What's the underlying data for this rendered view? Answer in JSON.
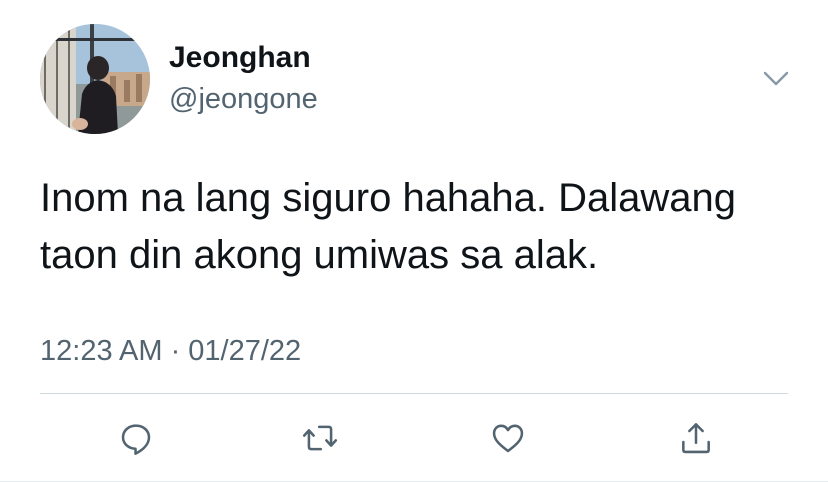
{
  "tweet": {
    "author": {
      "display_name": "Jeonghan",
      "handle": "@jeongone",
      "avatar_icon": "profile-photo"
    },
    "text_lines": [
      "Inom na lang siguro hahaha. Dalawang",
      "taon din akong umiwas sa alak."
    ],
    "timestamp": "12:23 AM · 01/27/22",
    "menu_icon": "chevron-down-icon",
    "actions": [
      {
        "name": "reply",
        "icon": "reply-icon"
      },
      {
        "name": "retweet",
        "icon": "retweet-icon"
      },
      {
        "name": "like",
        "icon": "heart-icon"
      },
      {
        "name": "share",
        "icon": "share-icon"
      }
    ],
    "colors": {
      "primary_text": "#0f1419",
      "secondary_text": "#536471",
      "icon": "#536471",
      "divider": "#cfd9de"
    }
  }
}
